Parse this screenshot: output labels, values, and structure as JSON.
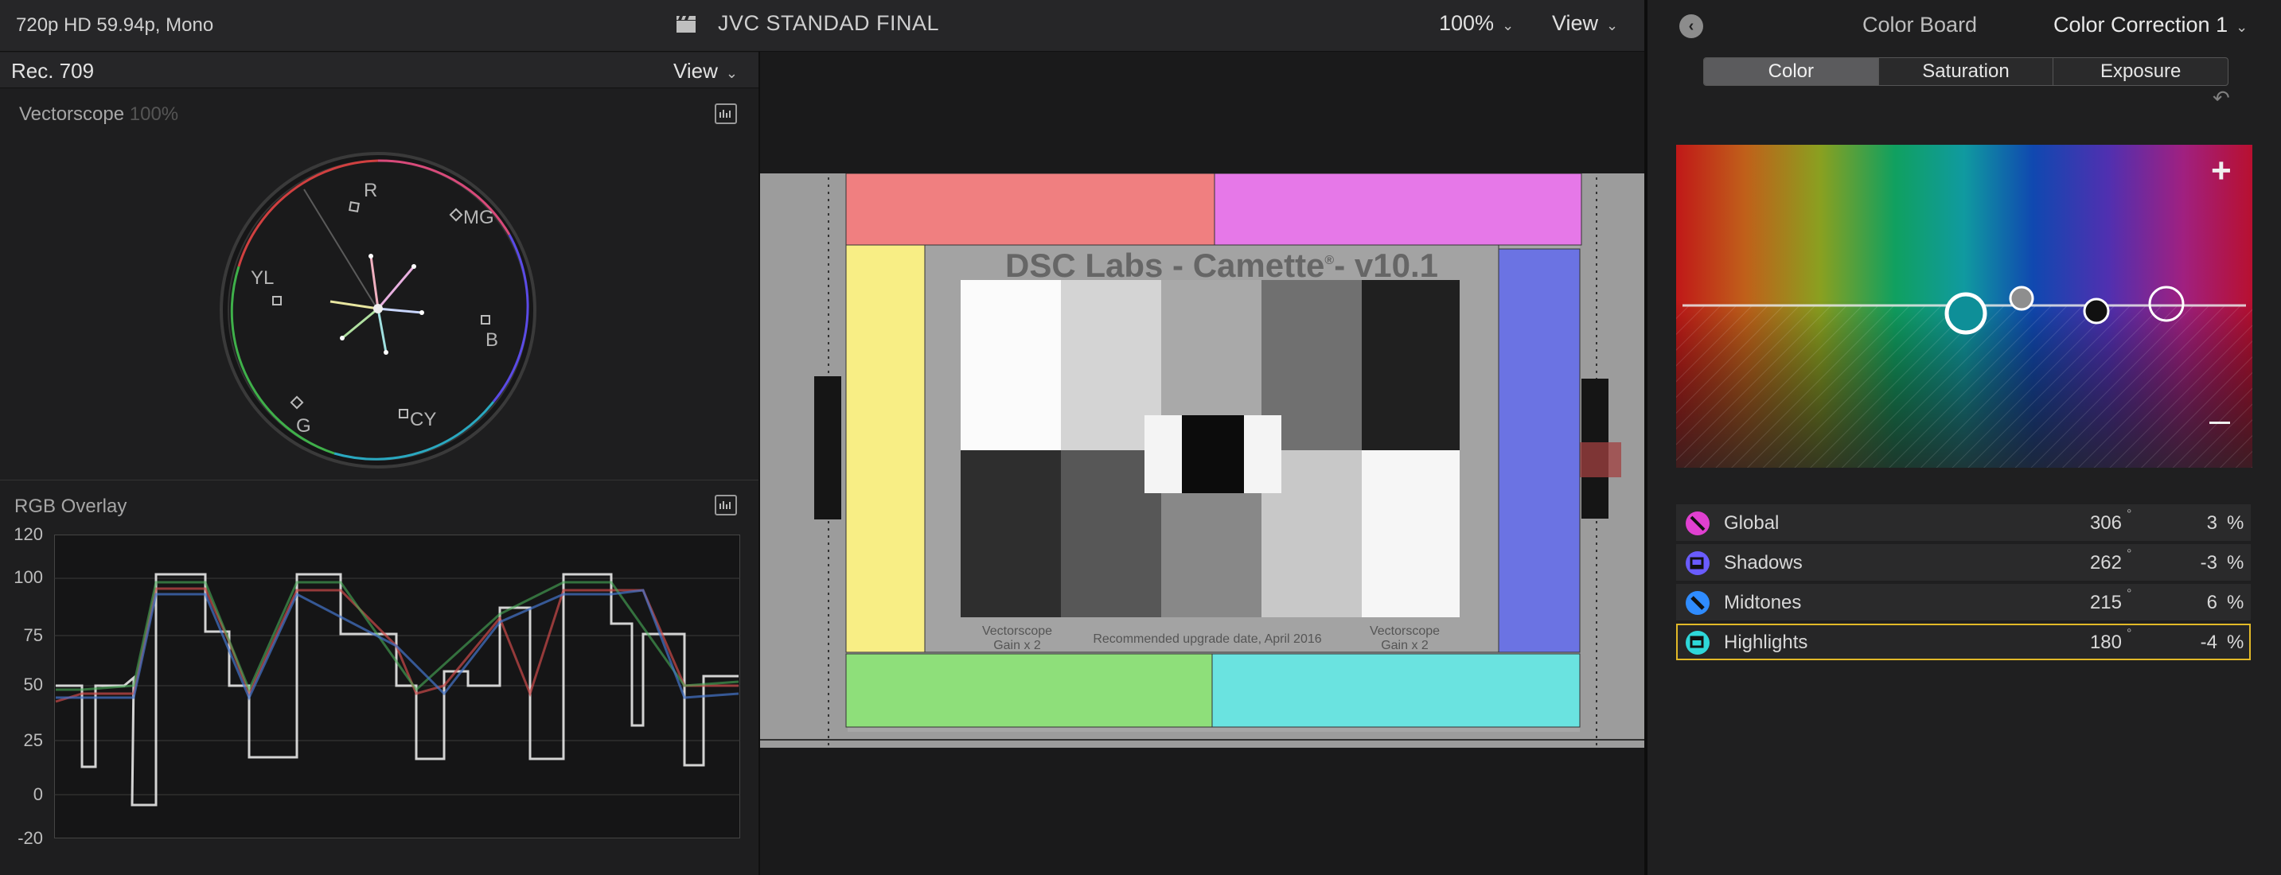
{
  "topbar": {
    "format": "720p HD 59.94p, Mono",
    "project_title": "JVC STANDAD FINAL",
    "zoom": "100%",
    "view_label": "View",
    "clapper_icon": "clapperboard-icon"
  },
  "scopes": {
    "colorspace": "Rec. 709",
    "view_label": "View",
    "vectorscope": {
      "title": "Vectorscope",
      "percent": "100%",
      "targets": [
        "R",
        "MG",
        "YL",
        "B",
        "G",
        "CY"
      ]
    },
    "rgb_overlay": {
      "title": "RGB Overlay",
      "y_ticks": [
        "120",
        "100",
        "75",
        "50",
        "25",
        "0",
        "-20"
      ]
    }
  },
  "viewer": {
    "chart_title": "DSC Labs - Camette",
    "chart_mark": "®",
    "chart_version": "- v10.1",
    "left_caption_1": "Vectorscope",
    "left_caption_2": "Gain x 2",
    "center_caption": "Recommended upgrade date, April 2016",
    "right_caption_1": "Vectorscope",
    "right_caption_2": "Gain x 2"
  },
  "inspector": {
    "board_title": "Color Board",
    "correction_title": "Color Correction 1",
    "tabs": [
      {
        "label": "Color",
        "active": true
      },
      {
        "label": "Saturation",
        "active": false
      },
      {
        "label": "Exposure",
        "active": false
      }
    ],
    "plus_label": "+",
    "rows": [
      {
        "name": "Global",
        "hue": "306",
        "deg": "°",
        "amount": "3",
        "unit": "%",
        "color": "#e040d0"
      },
      {
        "name": "Shadows",
        "hue": "262",
        "deg": "°",
        "amount": "-3",
        "unit": "%",
        "color": "#6a5cff"
      },
      {
        "name": "Midtones",
        "hue": "215",
        "deg": "°",
        "amount": "6",
        "unit": "%",
        "color": "#2f8cff"
      },
      {
        "name": "Highlights",
        "hue": "180",
        "deg": "°",
        "amount": "-4",
        "unit": "%",
        "color": "#2ed7d9"
      }
    ],
    "selected_row": "Highlights"
  }
}
